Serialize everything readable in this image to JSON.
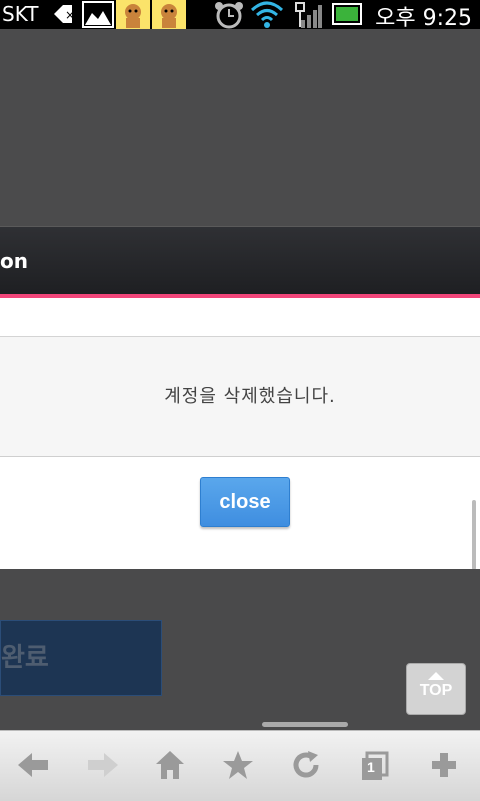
{
  "status_bar": {
    "carrier": "SKT",
    "time": "오후 9:25",
    "icons": [
      "back-notification-icon",
      "gallery-icon",
      "cookie-game-icon",
      "cookie-game-icon",
      "alarm-icon",
      "wifi-icon",
      "usb-icon",
      "signal-icon",
      "battery-icon"
    ]
  },
  "header": {
    "title_fragment": "on"
  },
  "dialog": {
    "message": "계정을 삭제했습니다.",
    "close_label": "close"
  },
  "page": {
    "complete_label": "완료",
    "top_label": "TOP"
  },
  "browser_bar": {
    "buttons": [
      "back-icon",
      "forward-icon",
      "home-icon",
      "bookmark-star-icon",
      "refresh-icon",
      "tabs-icon",
      "add-tab-icon"
    ],
    "tab_count": "1"
  },
  "colors": {
    "accent": "#f2467a",
    "button_blue": "#4a96e6",
    "dark_bg": "#4a4a4b"
  }
}
